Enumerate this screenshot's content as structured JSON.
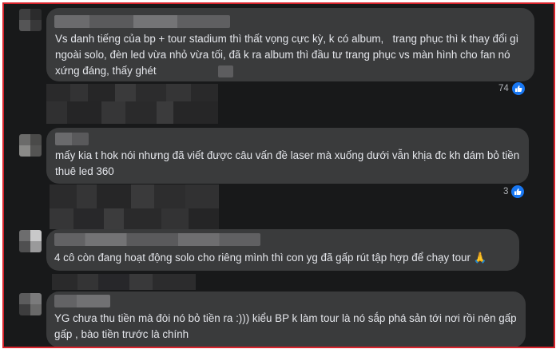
{
  "comments": [
    {
      "text": "Vs danh tiếng của bp + tour stadium thì thất vọng cực kỳ, k có album,   trang phục thì k thay đổi gì ngoài solo, đèn led vừa nhỏ vừa tối, đã k ra album thì đầu tư trang phục vs màn hình cho fan nó xứng đáng, thấy ghét",
      "reaction_count": "74",
      "reaction_icon": "like-icon"
    },
    {
      "text": "mấy kia t hok nói nhưng đã viết được câu vấn đề laser mà xuống dưới vẫn khịa đc kh dám bỏ tiền thuê led 360",
      "reaction_count": "3",
      "reaction_icon": "like-icon"
    },
    {
      "text": "4 cô còn đang hoạt động solo cho riêng mình thì con yg đã gấp rút tập hợp để chạy tour 🙏",
      "reaction_count": "",
      "reaction_icon": ""
    },
    {
      "text": "YG chưa thu tiền mà đòi nó bỏ tiền ra :))) kiểu BP k làm tour là nó sắp phá sản tới nơi rồi nên gấp gấp , bào tiền trước là chính",
      "reaction_count": "",
      "reaction_icon": ""
    }
  ],
  "colors": {
    "frame_border": "#d8242c",
    "background": "#18191a",
    "bubble": "#3a3b3c",
    "text": "#e4e6eb",
    "secondary_text": "#b0b3b8",
    "like_blue": "#1877f2"
  }
}
